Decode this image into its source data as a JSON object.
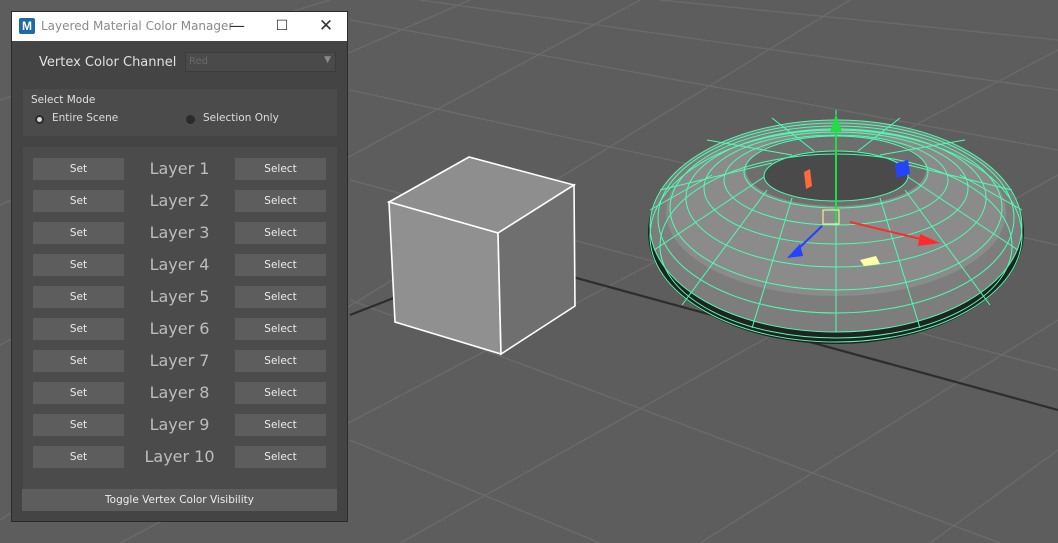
{
  "window": {
    "title": "Layered Material Color Manager",
    "app_icon": "M",
    "minimize_glyph": "—",
    "maximize_glyph": "☐",
    "close_glyph": "✕"
  },
  "vertex_color": {
    "label": "Vertex Color Channel",
    "selected": "Red"
  },
  "select_mode": {
    "title": "Select Mode",
    "options": [
      {
        "label": "Entire Scene",
        "selected": true
      },
      {
        "label": "Selection Only",
        "selected": false
      }
    ]
  },
  "layers": [
    {
      "name": "Layer 1",
      "set_label": "Set",
      "select_label": "Select"
    },
    {
      "name": "Layer 2",
      "set_label": "Set",
      "select_label": "Select"
    },
    {
      "name": "Layer 3",
      "set_label": "Set",
      "select_label": "Select"
    },
    {
      "name": "Layer 4",
      "set_label": "Set",
      "select_label": "Select"
    },
    {
      "name": "Layer 5",
      "set_label": "Set",
      "select_label": "Select"
    },
    {
      "name": "Layer 6",
      "set_label": "Set",
      "select_label": "Select"
    },
    {
      "name": "Layer 7",
      "set_label": "Set",
      "select_label": "Select"
    },
    {
      "name": "Layer 8",
      "set_label": "Set",
      "select_label": "Select"
    },
    {
      "name": "Layer 9",
      "set_label": "Set",
      "select_label": "Select"
    },
    {
      "name": "Layer 10",
      "set_label": "Set",
      "select_label": "Select"
    }
  ],
  "toggle_button": "Toggle Vertex Color Visibility",
  "colors": {
    "viewport_bg": "#5d5d5d",
    "grid_line": "#6a6a6a",
    "wireframe": "#4dffb0",
    "axis_x": "#ff2a2a",
    "axis_y": "#22dd44",
    "axis_z": "#2244ff"
  }
}
